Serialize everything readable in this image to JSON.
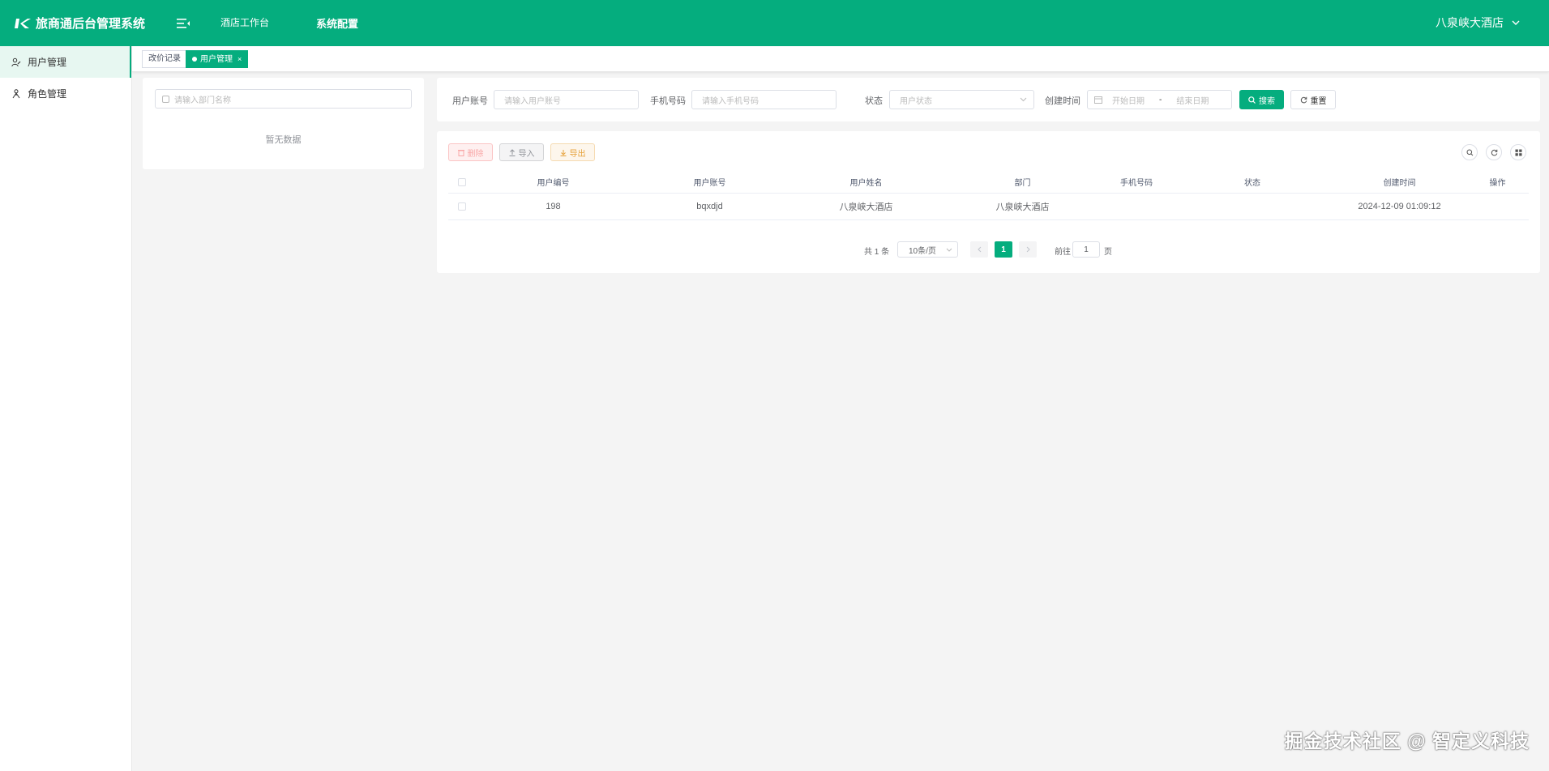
{
  "header": {
    "title": "旅商通后台管理系统",
    "nav": [
      {
        "label": "酒店工作台",
        "active": false
      },
      {
        "label": "系统配置",
        "active": true
      }
    ],
    "hotel": "八泉峡大酒店"
  },
  "sidebar": {
    "items": [
      {
        "label": "用户管理",
        "icon": "user-edit-icon",
        "active": true
      },
      {
        "label": "角色管理",
        "icon": "role-icon",
        "active": false
      }
    ]
  },
  "tabs": [
    {
      "label": "改价记录",
      "active": false
    },
    {
      "label": "用户管理",
      "active": true,
      "close": "×"
    }
  ],
  "dept_panel": {
    "placeholder": "请输入部门名称",
    "empty": "暂无数据"
  },
  "filters": {
    "account_label": "用户账号",
    "account_placeholder": "请输入用户账号",
    "phone_label": "手机号码",
    "phone_placeholder": "请输入手机号码",
    "status_label": "状态",
    "status_placeholder": "用户状态",
    "time_label": "创建时间",
    "start_placeholder": "开始日期",
    "range_sep": "-",
    "end_placeholder": "结束日期",
    "search_label": "搜索",
    "reset_label": "重置"
  },
  "toolbar": {
    "delete_label": "删除",
    "import_label": "导入",
    "export_label": "导出"
  },
  "table": {
    "columns": [
      "用户编号",
      "用户账号",
      "用户姓名",
      "部门",
      "手机号码",
      "状态",
      "创建时间",
      "操作"
    ],
    "rows": [
      {
        "id": "198",
        "account": "bqxdjd",
        "name": "八泉峡大酒店",
        "dept": "八泉峡大酒店",
        "phone": "",
        "status": "",
        "created": "2024-12-09 01:09:12",
        "ops": ""
      }
    ]
  },
  "pagination": {
    "total": "共 1 条",
    "page_size": "10条/页",
    "current": "1",
    "goto_label": "前往",
    "goto_value": "1",
    "unit": "页"
  },
  "watermark": "掘金技术社区 @ 智定义科技",
  "colors": {
    "brand": "#05ad7e"
  }
}
